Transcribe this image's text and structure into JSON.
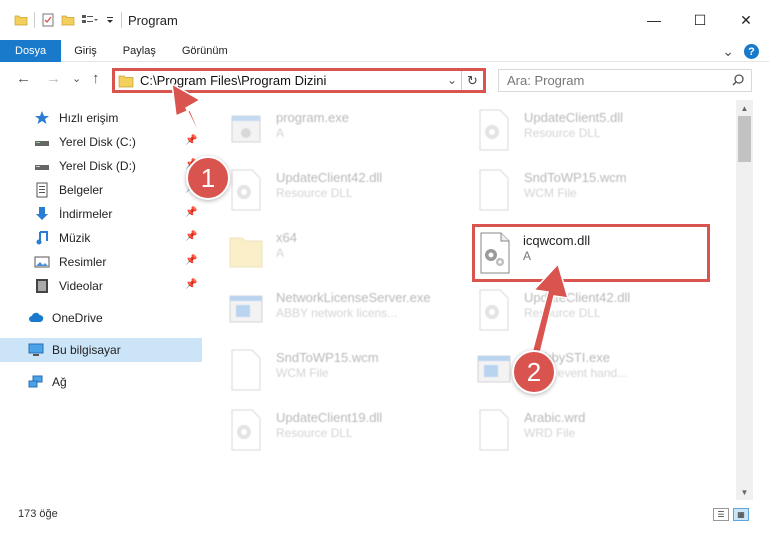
{
  "window": {
    "title": "Program",
    "minimize": "—",
    "maximize": "☐",
    "close": "✕"
  },
  "ribbon": {
    "tabs": [
      "Dosya",
      "Giriş",
      "Paylaş",
      "Görünüm"
    ],
    "expand": "⌄",
    "help": "?"
  },
  "nav": {
    "back": "←",
    "forward": "→",
    "recent": "⌄",
    "up": "↑",
    "address": "C:\\Program Files\\Program Dizini",
    "address_dropdown": "⌄",
    "refresh": "↻",
    "search_placeholder": "Ara: Program"
  },
  "sidebar": {
    "items": [
      {
        "label": "Hızlı erişim",
        "icon": "star-icon"
      },
      {
        "label": "Yerel Disk (C:)",
        "icon": "drive-icon"
      },
      {
        "label": "Yerel Disk (D:)",
        "icon": "drive-icon"
      },
      {
        "label": "Belgeler",
        "icon": "documents-icon"
      },
      {
        "label": "İndirmeler",
        "icon": "downloads-icon"
      },
      {
        "label": "Müzik",
        "icon": "music-icon"
      },
      {
        "label": "Resimler",
        "icon": "pictures-icon"
      },
      {
        "label": "Videolar",
        "icon": "videos-icon"
      },
      {
        "label": "OneDrive",
        "icon": "cloud-icon"
      },
      {
        "label": "Bu bilgisayar",
        "icon": "computer-icon"
      },
      {
        "label": "Ağ",
        "icon": "network-icon"
      }
    ],
    "pin": "📌"
  },
  "files": [
    {
      "name": "program.exe",
      "sub": "A",
      "type": "exe"
    },
    {
      "name": "UpdateClient5.dll",
      "sub": "Resource DLL",
      "type": "dll"
    },
    {
      "name": "UpdateClient42.dll",
      "sub": "Resource DLL",
      "type": "dll"
    },
    {
      "name": "SndToWP15.wcm",
      "sub": "WCM File",
      "type": "doc"
    },
    {
      "name": "x64",
      "sub": "A",
      "type": "folder"
    },
    {
      "name": "icqwcom.dll",
      "sub": "A",
      "type": "dll"
    },
    {
      "name": "NetworkLicenseServer.exe",
      "sub": "ABBY network licens...",
      "type": "app"
    },
    {
      "name": "UpdateClient42.dll",
      "sub": "Resource DLL",
      "type": "dll"
    },
    {
      "name": "SndToWP15.wcm",
      "sub": "WCM File",
      "type": "doc"
    },
    {
      "name": "ArabbySTI.exe",
      "sub": "ST sti event hand...",
      "type": "app"
    },
    {
      "name": "UpdateClient19.dll",
      "sub": "Resource DLL",
      "type": "dll"
    },
    {
      "name": "Arabic.wrd",
      "sub": "WRD File",
      "type": "doc"
    }
  ],
  "status": {
    "count": "173 öğe"
  },
  "callouts": [
    "1",
    "2"
  ],
  "colors": {
    "accent": "#1979ca",
    "highlight": "#d9534f",
    "selected": "#cce4f7"
  }
}
